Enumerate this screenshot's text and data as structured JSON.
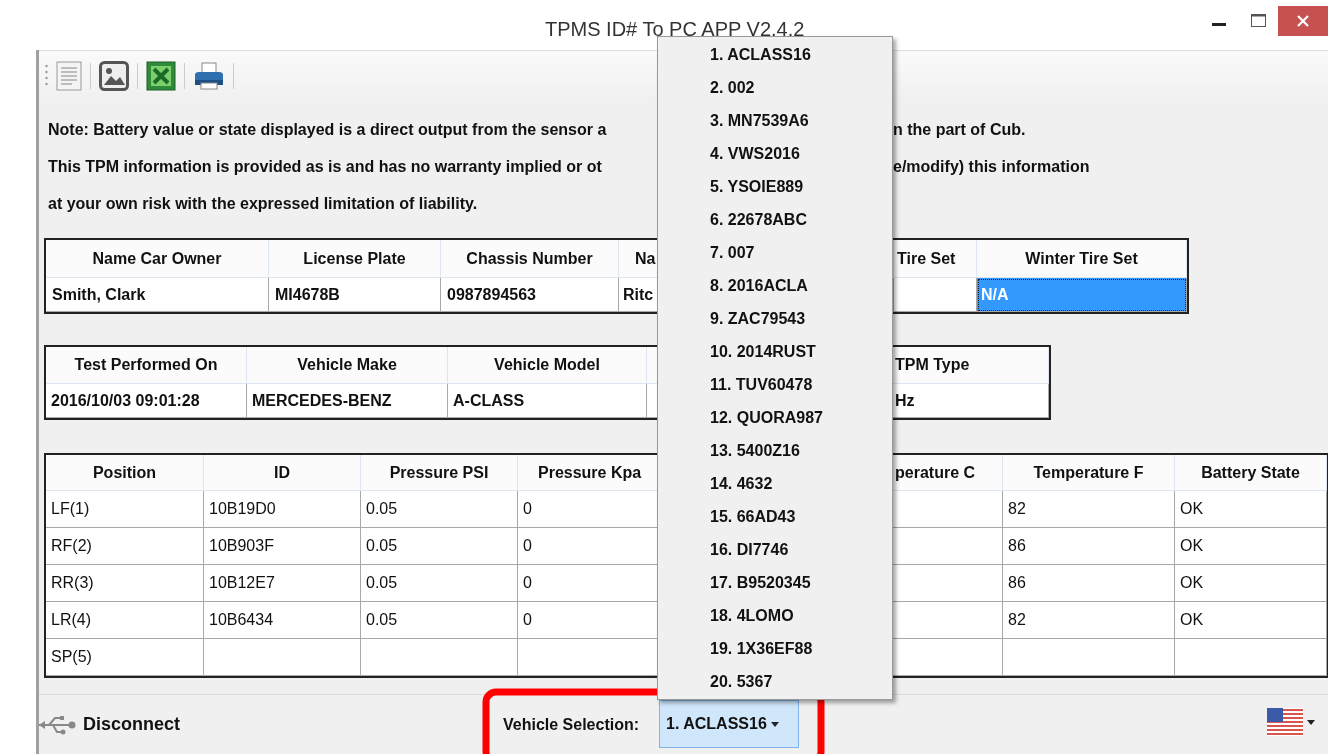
{
  "window": {
    "title": "TPMS ID# To PC APP V2.4.2"
  },
  "notes": [
    {
      "left": "Note: Battery value or state displayed is a direct output from the sensor a",
      "right": "n the part of Cub."
    },
    {
      "left": "This TPM information is provided as is and has no warranty implied or ot",
      "right": "e/modify) this information"
    },
    {
      "left": "at your own risk with the expressed limitation of liability."
    }
  ],
  "owner_table": {
    "columns": [
      "Name Car Owner",
      "License Plate",
      "Chassis Number",
      "Na",
      "Tire Set",
      "Winter Tire Set"
    ],
    "rows": [
      [
        {
          "text": "Smith, Clark",
          "selected": false
        },
        {
          "text": "MI4678B",
          "selected": false
        },
        {
          "text": "0987894563",
          "selected": false
        },
        {
          "text": "Ritc",
          "selected": false
        },
        {
          "text": null,
          "selected": false
        },
        {
          "text": "N/A",
          "selected": true
        }
      ]
    ]
  },
  "vehicle_table": {
    "columns": [
      "Test Performed On",
      "Vehicle Make",
      "Vehicle Model",
      null,
      "TPM Type"
    ],
    "rows": [
      [
        "2016/10/03   09:01:28",
        "MERCEDES-BENZ",
        "A-CLASS",
        null,
        "Hz"
      ]
    ]
  },
  "sensor_table": {
    "columns": [
      "Position",
      "ID",
      "Pressure PSI",
      "Pressure Kpa",
      null,
      "perature C",
      "Temperature F",
      "Battery State"
    ],
    "rows": [
      [
        "LF(1)",
        "10B19D0",
        "0.05",
        "0",
        null,
        null,
        "82",
        "OK"
      ],
      [
        "RF(2)",
        "10B903F",
        "0.05",
        "0",
        null,
        null,
        "86",
        "OK"
      ],
      [
        "RR(3)",
        "10B12E7",
        "0.05",
        "0",
        null,
        null,
        "86",
        "OK"
      ],
      [
        "LR(4)",
        "10B6434",
        "0.05",
        "0",
        null,
        null,
        "82",
        "OK"
      ],
      [
        "SP(5)",
        null,
        null,
        null,
        null,
        null,
        null,
        null
      ]
    ]
  },
  "status_bar": {
    "disconnect": "Disconnect"
  },
  "vehicle_selection": {
    "label": "Vehicle Selection:",
    "value": "1. ACLASS16",
    "expanded": true,
    "options": [
      "1. ACLASS16",
      "2. 002",
      "3. MN7539A6",
      "4. VWS2016",
      "5. YSOIE889",
      "6. 22678ABC",
      "7. 007",
      "8. 2016ACLA",
      "9. ZAC79543",
      "10. 2014RUST",
      "11. TUV60478",
      "12. QUORA987",
      "13. 5400Z16",
      "14. 4632",
      "15. 66AD43",
      "16. DI7746",
      "17. B9520345",
      "18. 4LOMO",
      "19. 1X36EF88",
      "20. 5367"
    ]
  }
}
